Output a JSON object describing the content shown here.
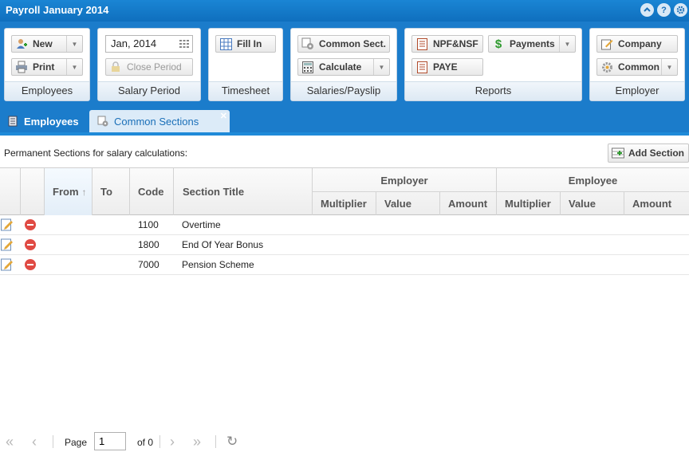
{
  "window": {
    "title": "Payroll January 2014"
  },
  "ribbon": {
    "employees": {
      "label": "Employees",
      "new_label": "New",
      "print_label": "Print"
    },
    "salary_period": {
      "label": "Salary Period",
      "period_value": "Jan, 2014",
      "close_label": "Close Period"
    },
    "timesheet": {
      "label": "Timesheet",
      "fill_in_label": "Fill In"
    },
    "salaries": {
      "label": "Salaries/Payslip",
      "common_sect_label": "Common Sect.",
      "calculate_label": "Calculate"
    },
    "reports": {
      "label": "Reports",
      "npf_label": "NPF&NSF",
      "payments_label": "Payments",
      "paye_label": "PAYE"
    },
    "employer": {
      "label": "Employer",
      "company_label": "Company",
      "common_label": "Common"
    }
  },
  "tabs": [
    {
      "label": "Employees"
    },
    {
      "label": "Common Sections"
    }
  ],
  "section": {
    "caption": "Permanent Sections for salary calculations:",
    "add_label": "Add Section"
  },
  "grid": {
    "headers": {
      "from": "From",
      "to": "To",
      "code": "Code",
      "title": "Section Title",
      "employer": "Employer",
      "employee": "Employee",
      "multiplier": "Multiplier",
      "value": "Value",
      "amount": "Amount"
    },
    "rows": [
      {
        "code": "1100",
        "title": "Overtime"
      },
      {
        "code": "1800",
        "title": "End Of Year Bonus"
      },
      {
        "code": "7000",
        "title": "Pension Scheme"
      }
    ]
  },
  "pager": {
    "page_label": "Page",
    "page_value": "1",
    "of_label": "of 0"
  },
  "colors": {
    "accent": "#1b7ccb",
    "title_bar": "#1a85d4",
    "active_tab": "#dcebf8",
    "delete_red": "#e04a43"
  }
}
